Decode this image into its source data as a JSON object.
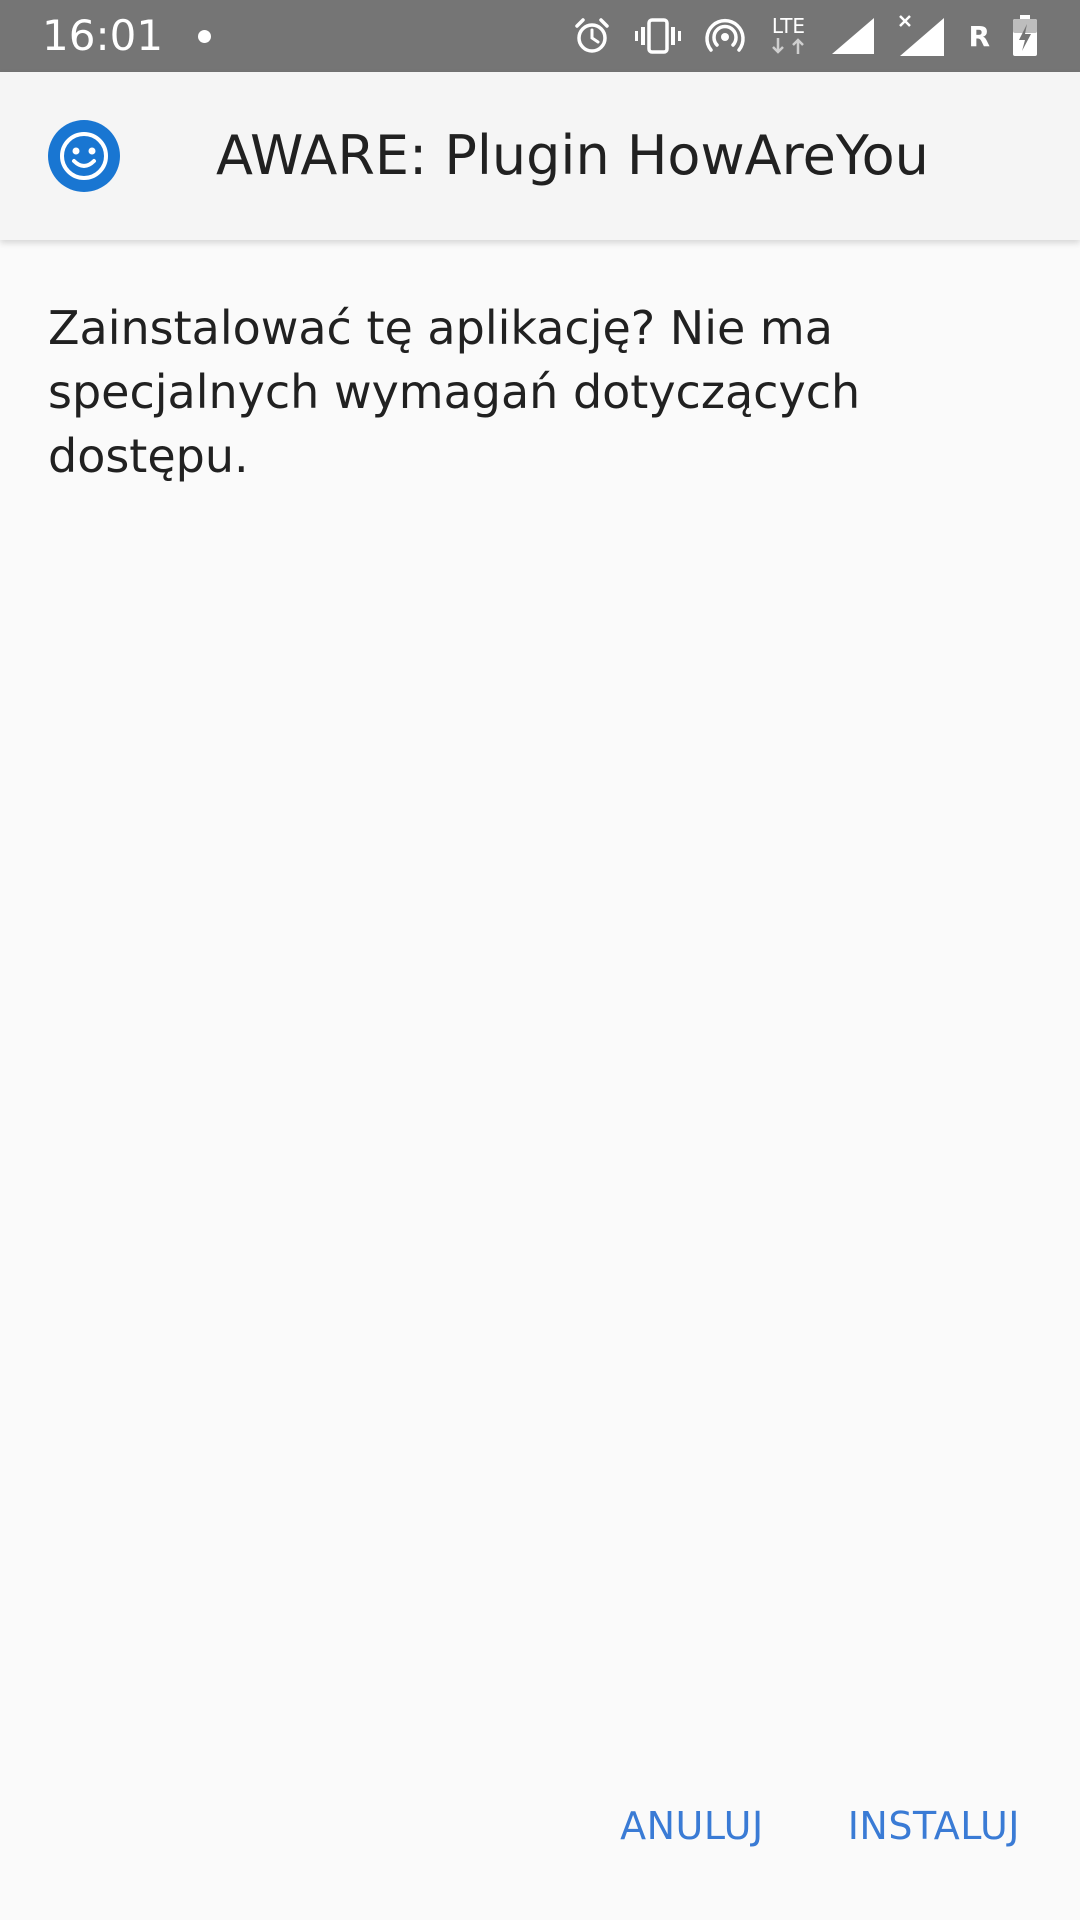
{
  "status_bar": {
    "time": "16:01",
    "lte_label": "LTE",
    "roaming_label": "R",
    "icons": [
      "notification-dot-icon",
      "alarm-icon",
      "vibrate-icon",
      "hotspot-icon",
      "lte-data-icon",
      "signal-icon",
      "signal-no-data-icon",
      "roaming-icon",
      "battery-charging-icon"
    ]
  },
  "app_bar": {
    "icon": "smiley-face-icon",
    "title": "AWARE: Plugin HowAreYou"
  },
  "content": {
    "message": "Zainstalować tę aplikację? Nie ma specjalnych wymagań dotyczących dostępu."
  },
  "buttons": {
    "cancel_label": "ANULUJ",
    "install_label": "INSTALUJ"
  },
  "colors": {
    "status_bar": "#757575",
    "accent": "#3a7bd5",
    "app_icon": "#1976d2"
  }
}
